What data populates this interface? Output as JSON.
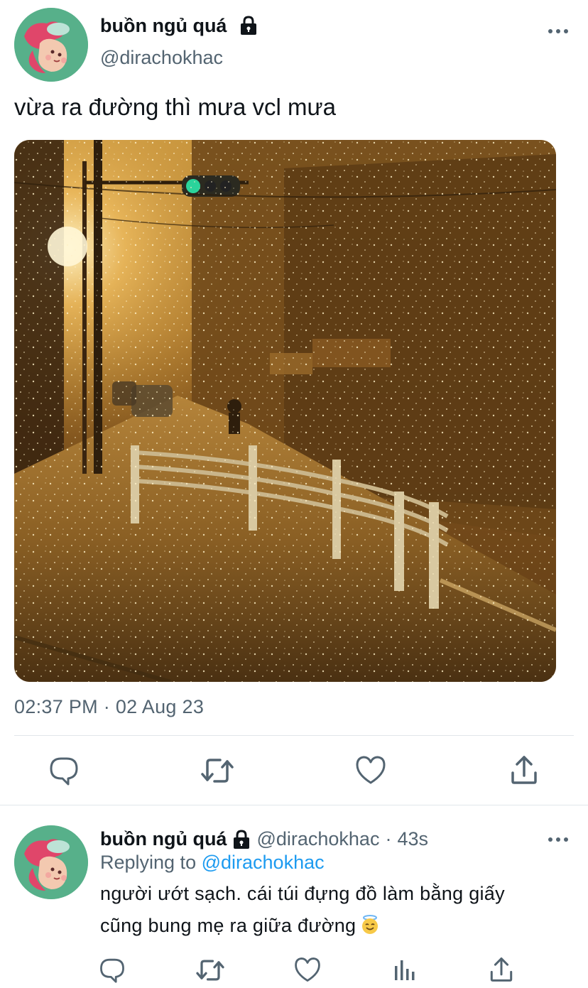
{
  "main_tweet": {
    "display_name": "buồn ngủ quá",
    "handle": "@dirachokhac",
    "text": "vừa ra đường thì mưa vcl mưa",
    "timestamp": "02:37 PM · 02 Aug 23",
    "icons": {
      "lock": "lock-icon",
      "more": "more-icon",
      "reply": "reply-icon",
      "retweet": "retweet-icon",
      "like": "heart-icon",
      "share": "share-icon"
    }
  },
  "reply_tweet": {
    "display_name": "buồn ngủ quá",
    "handle": "@dirachokhac",
    "separator": "·",
    "time": "43s",
    "replying_label": "Replying to",
    "replying_handle": "@dirachokhac",
    "text_line_1": "người ướt sạch. cái túi đựng đồ làm bằng giấy",
    "text_line_2": "cũng bung mẹ ra giữa đường",
    "emoji": "smiling-face-with-halo"
  },
  "colors": {
    "text_primary": "#0f1419",
    "text_secondary": "#536471",
    "link": "#1d9bf0",
    "divider": "#e1e6ea",
    "icon": "#536471",
    "avatar_bg": "#57b08a"
  }
}
